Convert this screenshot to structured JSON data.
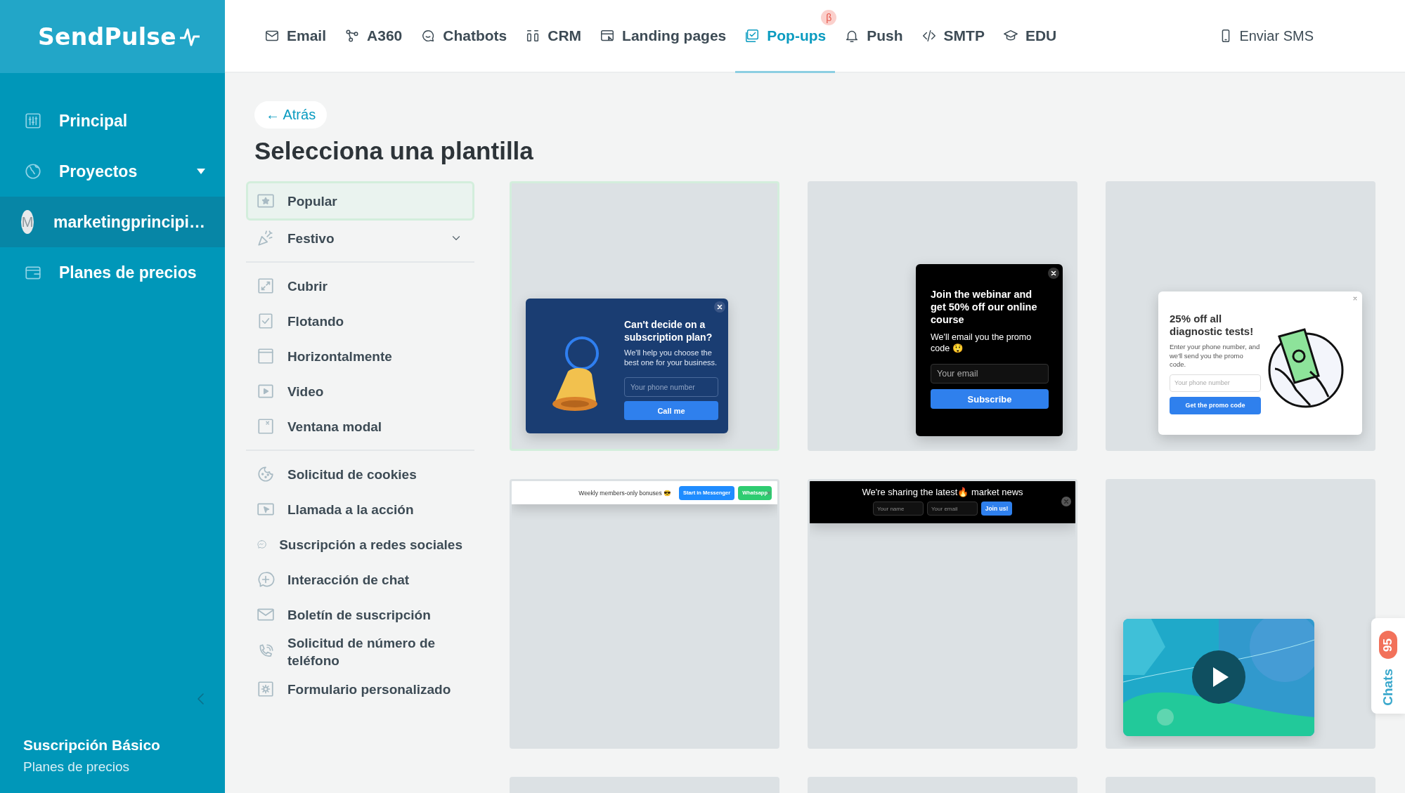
{
  "brand": {
    "name": "SendPulse"
  },
  "nav": {
    "items": [
      {
        "label": "Email",
        "selected": false
      },
      {
        "label": "A360",
        "selected": false
      },
      {
        "label": "Chatbots",
        "selected": false
      },
      {
        "label": "CRM",
        "selected": false
      },
      {
        "label": "Landing pages",
        "selected": false
      },
      {
        "label": "Pop-ups",
        "selected": true,
        "badge": "β"
      },
      {
        "label": "Push",
        "selected": false
      },
      {
        "label": "SMTP",
        "selected": false
      },
      {
        "label": "EDU",
        "selected": false
      }
    ],
    "sms": "Enviar SMS"
  },
  "sidebar": {
    "items": [
      {
        "label": "Principal",
        "selected": false
      },
      {
        "label": "Proyectos",
        "selected": false,
        "expanded": false
      },
      {
        "label": "marketingprincipi…",
        "selected": true,
        "avatar": "M"
      },
      {
        "label": "Planes de precios",
        "selected": false
      }
    ],
    "plan": {
      "title": "Suscripción Básico",
      "link": "Planes de precios"
    }
  },
  "back_button": "← Atrás",
  "title": "Selecciona una plantilla",
  "category_groups": [
    [
      {
        "label": "Popular",
        "selected": true
      },
      {
        "label": "Festivo",
        "selected": false,
        "expanded": false
      }
    ],
    [
      {
        "label": "Cubrir",
        "selected": false
      },
      {
        "label": "Flotando",
        "selected": false
      },
      {
        "label": "Horizontalmente",
        "selected": false
      },
      {
        "label": "Video",
        "selected": false
      },
      {
        "label": "Ventana modal",
        "selected": false
      }
    ],
    [
      {
        "label": "Solicitud de cookies",
        "selected": false
      },
      {
        "label": "Llamada a la acción",
        "selected": false
      },
      {
        "label": "Suscripción a redes sociales",
        "selected": false
      },
      {
        "label": "Interacción de chat",
        "selected": false
      },
      {
        "label": "Boletín de suscripción",
        "selected": false
      },
      {
        "label": "Solicitud de número de teléfono",
        "selected": false
      },
      {
        "label": "Formulario personalizado",
        "selected": false
      }
    ]
  ],
  "templates": [
    {
      "kind": "bell-modal",
      "selected": true,
      "title": "Can't decide on a subscription plan?",
      "text": "We'll help you choose the best one for your business.",
      "placeholder": "Your phone number",
      "button": "Call me"
    },
    {
      "kind": "webinar-modal",
      "selected": false,
      "title": "Join the webinar and get 50% off our online course",
      "text": "We'll email you the promo code 😲",
      "placeholder": "Your email",
      "button": "Subscribe"
    },
    {
      "kind": "promo-modal",
      "selected": false,
      "title": "25% off all diagnostic tests!",
      "text": "Enter your phone number, and we'll send you the promo code.",
      "placeholder": "Your phone number",
      "button": "Get the promo code"
    },
    {
      "kind": "messenger-bar",
      "selected": false,
      "text": "Weekly members-only bonuses 😎",
      "buttons": [
        "Start in Messenger",
        "Whatsapp"
      ]
    },
    {
      "kind": "news-bar",
      "selected": false,
      "title": "We're sharing the latest🔥 market news",
      "placeholders": [
        "Your name",
        "Your email"
      ],
      "button": "Join us!"
    },
    {
      "kind": "video",
      "selected": false
    },
    {
      "kind": "blank",
      "selected": false
    },
    {
      "kind": "blank",
      "selected": false
    },
    {
      "kind": "blank",
      "selected": false
    }
  ],
  "chats": {
    "label": "Chats",
    "badge": "95"
  }
}
